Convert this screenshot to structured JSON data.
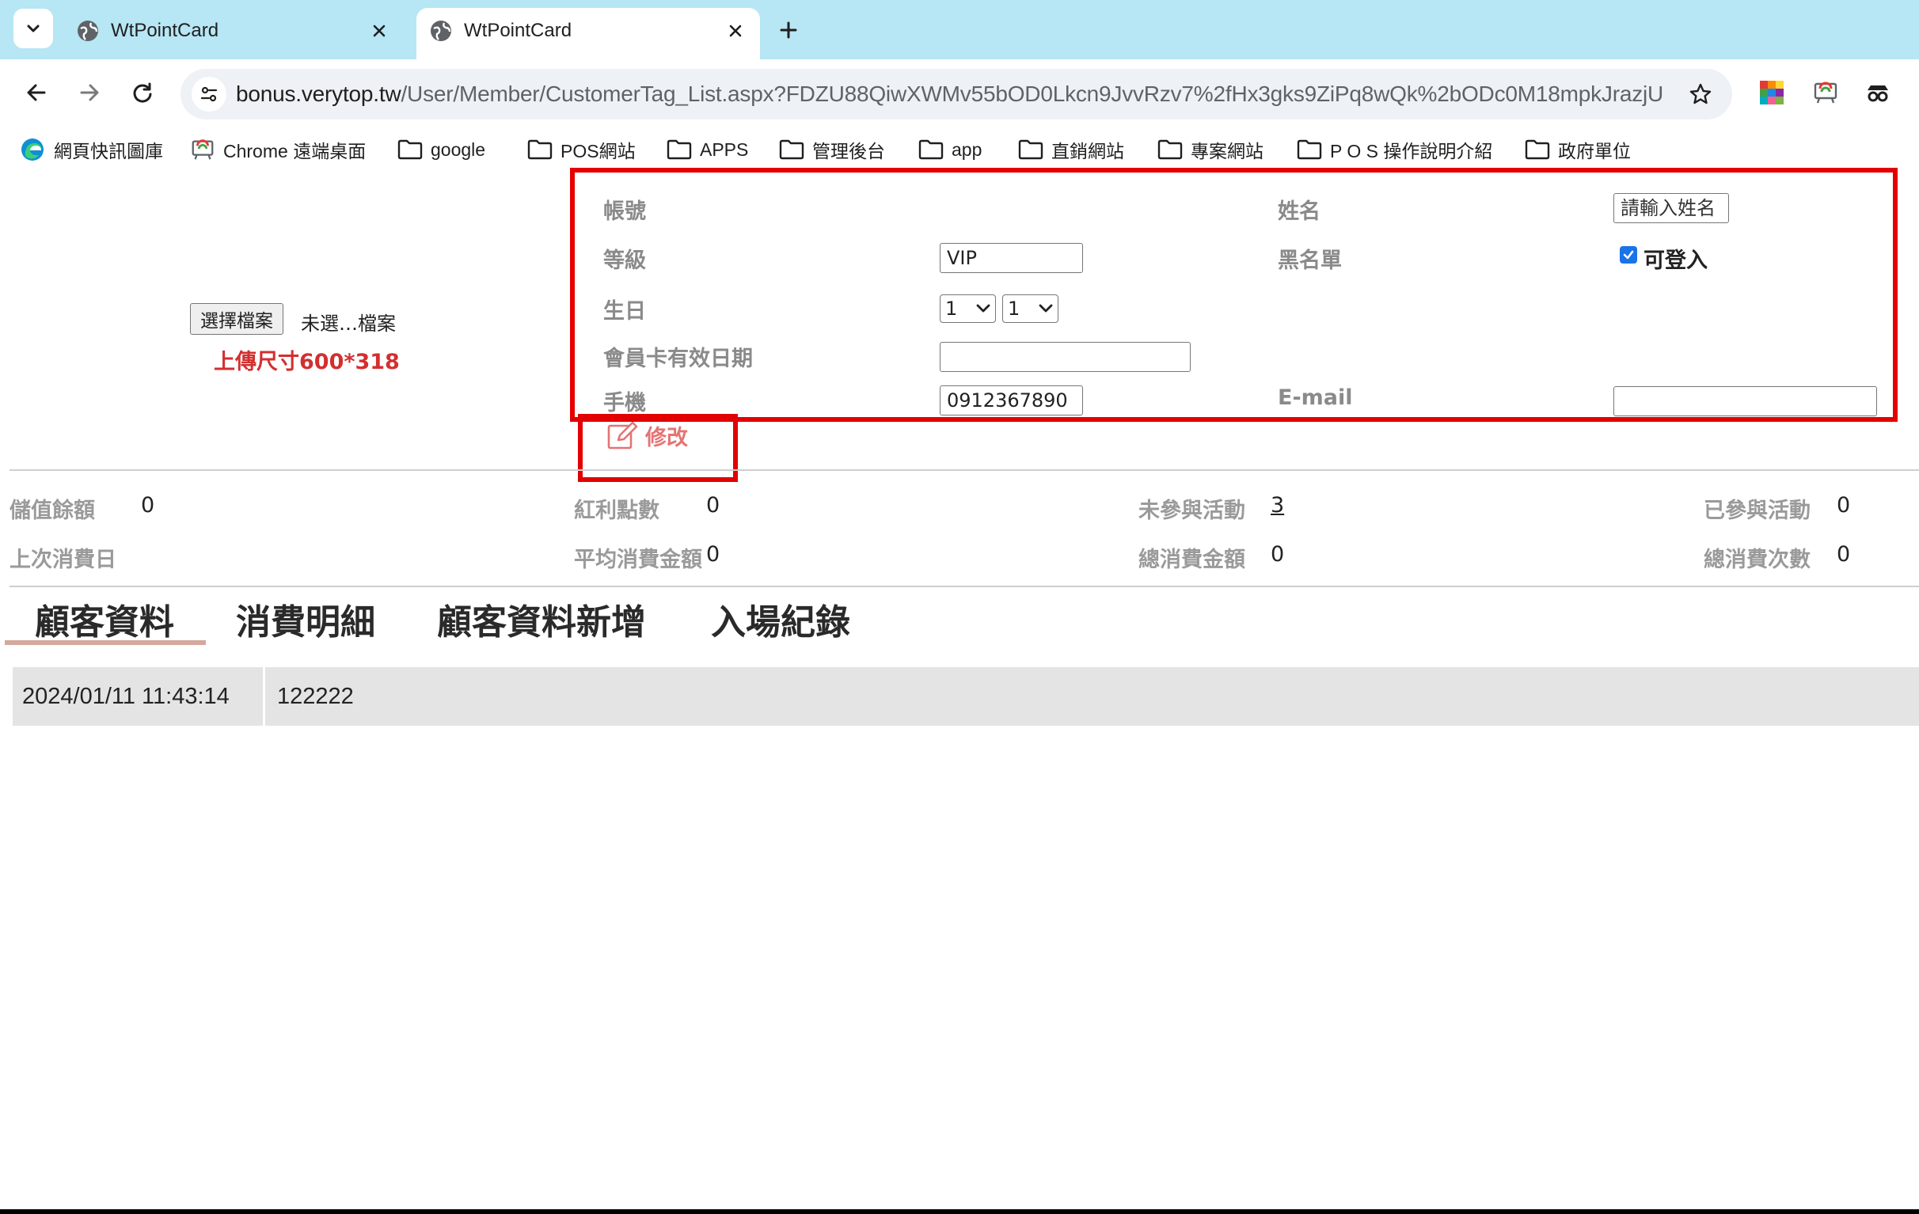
{
  "browser": {
    "tabs": [
      {
        "title": "WtPointCard",
        "active": false
      },
      {
        "title": "WtPointCard",
        "active": true
      }
    ],
    "url": {
      "host": "bonus.verytop.tw",
      "path": "/User/Member/CustomerTag_List.aspx?FDZU88QiwXWMv55bOD0Lkcn9JvvRzv7%2fHx3gks9ZiPq8wQk%2bODc0M18mpkJrazjU"
    },
    "bookmarks": [
      {
        "label": "網頁快訊圖庫",
        "icon": "edge-icon"
      },
      {
        "label": "Chrome 遠端桌面",
        "icon": "remote-desktop-icon"
      },
      {
        "label": "google",
        "icon": "folder-icon"
      },
      {
        "label": "POS網站",
        "icon": "folder-icon"
      },
      {
        "label": "APPS",
        "icon": "folder-icon"
      },
      {
        "label": "管理後台",
        "icon": "folder-icon"
      },
      {
        "label": "app",
        "icon": "folder-icon"
      },
      {
        "label": "直銷網站",
        "icon": "folder-icon"
      },
      {
        "label": "專案網站",
        "icon": "folder-icon"
      },
      {
        "label": "P O S 操作說明介紹",
        "icon": "folder-icon"
      },
      {
        "label": "政府單位",
        "icon": "folder-icon"
      }
    ]
  },
  "upload": {
    "button_label": "選擇檔案",
    "status": "未選…檔案",
    "size_hint": "上傳尺寸600*318"
  },
  "form": {
    "account_label": "帳號",
    "name_label": "姓名",
    "name_placeholder": "請輸入姓名",
    "level_label": "等級",
    "level_value": "VIP",
    "blacklist_label": "黑名單",
    "can_login_label": "可登入",
    "can_login_checked": true,
    "birthday_label": "生日",
    "birthday_month": "1",
    "birthday_day": "1",
    "card_expiry_label": "會員卡有效日期",
    "card_expiry_value": "",
    "phone_label": "手機",
    "phone_value": "0912367890",
    "email_label": "E-mail",
    "email_value": "",
    "edit_label": "修改"
  },
  "stats": {
    "stored_balance_label": "儲值餘額",
    "stored_balance_value": "0",
    "bonus_points_label": "紅利點數",
    "bonus_points_value": "0",
    "not_joined_label": "未參與活動",
    "not_joined_value": "3",
    "joined_label": "已參與活動",
    "joined_value": "0",
    "last_purchase_label": "上次消費日",
    "last_purchase_value": "",
    "avg_amount_label": "平均消費金額",
    "avg_amount_value": "0",
    "total_amount_label": "總消費金額",
    "total_amount_value": "0",
    "total_count_label": "總消費次數",
    "total_count_value": "0"
  },
  "page_tabs": [
    "顧客資料",
    "消費明細",
    "顧客資料新增",
    "入場紀錄"
  ],
  "active_tab": "顧客資料",
  "records": [
    {
      "datetime": "2024/01/11 11:43:14",
      "value": "122222"
    }
  ],
  "colors": {
    "highlight": "#e30000",
    "tabstrip": "#b7e6f4",
    "size_hint": "#d32f2f"
  }
}
